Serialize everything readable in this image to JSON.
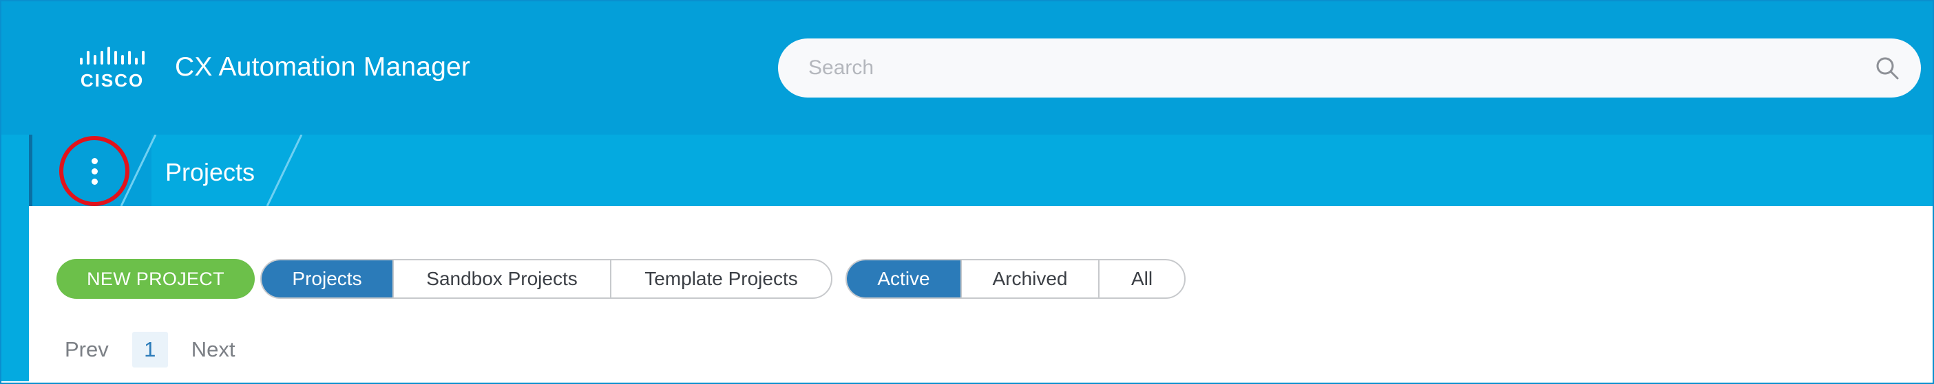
{
  "header": {
    "logo_text": "cisco",
    "app_title": "CX Automation Manager",
    "search": {
      "placeholder": "Search",
      "value": "",
      "icon": "search-icon"
    }
  },
  "breadcrumb": {
    "menu_icon": "kebab-menu-icon",
    "items": [
      {
        "label": "Projects"
      }
    ]
  },
  "toolbar": {
    "new_project_label": "NEW PROJECT",
    "project_types": [
      {
        "label": "Projects",
        "active": true
      },
      {
        "label": "Sandbox Projects",
        "active": false
      },
      {
        "label": "Template Projects",
        "active": false
      }
    ],
    "status_filters": [
      {
        "label": "Active",
        "active": true
      },
      {
        "label": "Archived",
        "active": false
      },
      {
        "label": "All",
        "active": false
      }
    ]
  },
  "pagination": {
    "prev_label": "Prev",
    "current_page": "1",
    "next_label": "Next"
  },
  "colors": {
    "header": "#049fd9",
    "breadcrumb_bar": "#04aae0",
    "accent_green": "#6cc04a",
    "active_segment": "#2b7bb9",
    "highlight_circle": "#e2121b"
  }
}
